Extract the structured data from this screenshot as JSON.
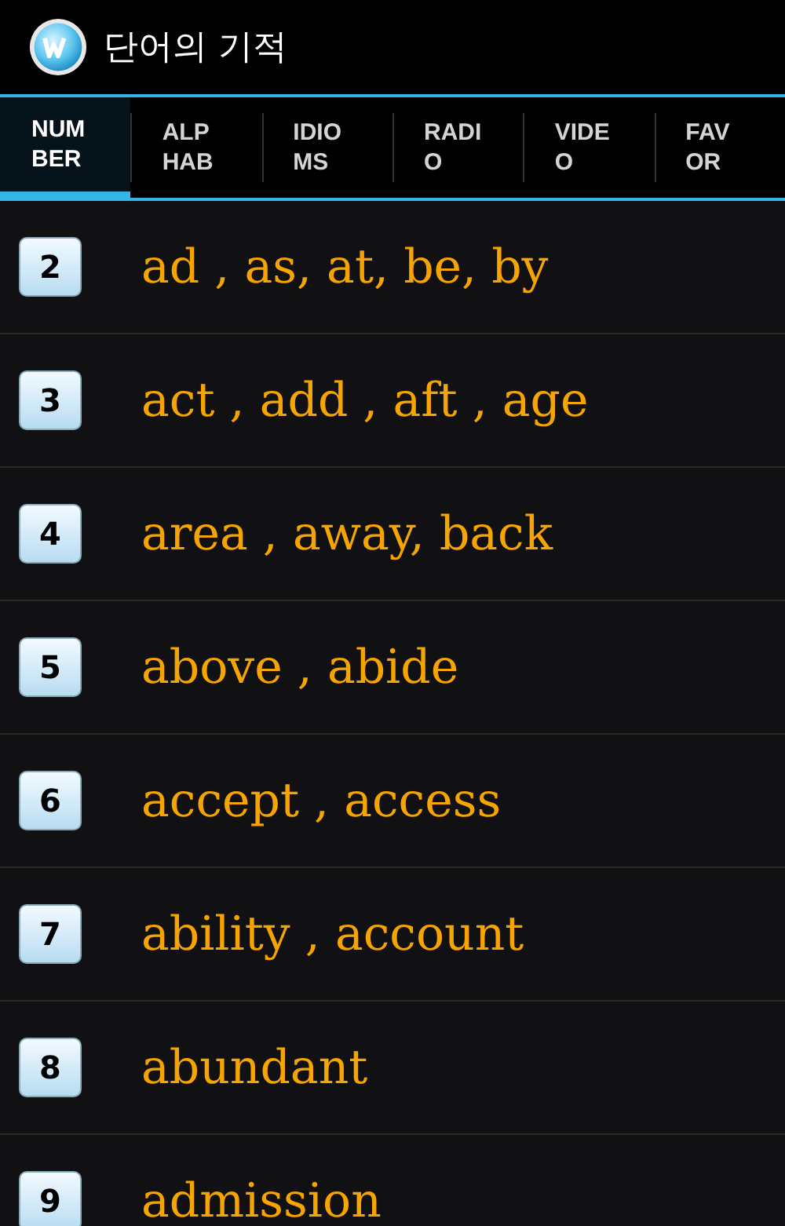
{
  "app_bar": {
    "title": "단어의 기적"
  },
  "tabs": [
    {
      "label_lines": [
        "NUM",
        "BER"
      ],
      "selected": true
    },
    {
      "label_lines": [
        "ALP",
        "HAB"
      ],
      "selected": false
    },
    {
      "label_lines": [
        "IDIO",
        "MS"
      ],
      "selected": false
    },
    {
      "label_lines": [
        "RADI",
        "O"
      ],
      "selected": false
    },
    {
      "label_lines": [
        "VIDE",
        "O"
      ],
      "selected": false
    },
    {
      "label_lines": [
        "FAV",
        "OR"
      ],
      "selected": false
    }
  ],
  "rows": [
    {
      "number": "2",
      "words": "ad , as, at, be, by"
    },
    {
      "number": "3",
      "words": "act , add , aft , age"
    },
    {
      "number": "4",
      "words": "area , away, back"
    },
    {
      "number": "5",
      "words": "above , abide"
    },
    {
      "number": "6",
      "words": "accept , access"
    },
    {
      "number": "7",
      "words": "ability , account"
    },
    {
      "number": "8",
      "words": "abundant"
    },
    {
      "number": "9",
      "words": "admission"
    }
  ]
}
